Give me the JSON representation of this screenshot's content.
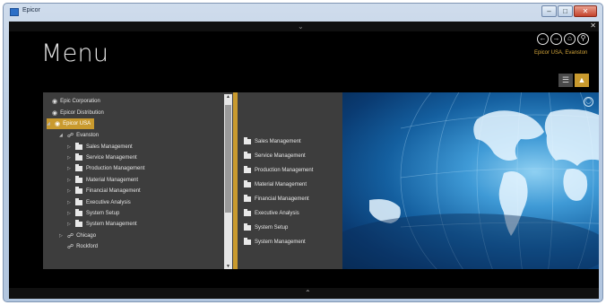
{
  "window": {
    "title": "Epicor"
  },
  "page": {
    "title": "Menu",
    "company_link": "Epicor USA, Evanston"
  },
  "toolbar": {
    "icons": [
      "back-icon",
      "forward-icon",
      "home-icon",
      "search-icon"
    ],
    "view_buttons": [
      "list-view-icon",
      "tile-view-icon"
    ]
  },
  "tree": [
    {
      "label": "Epic Corporation",
      "depth": 0,
      "icon": "company-icon"
    },
    {
      "label": "Epicor Distribution",
      "depth": 0,
      "icon": "company-icon"
    },
    {
      "label": "Epicor USA",
      "depth": 0,
      "icon": "company-icon",
      "selected": true,
      "expanded": true
    },
    {
      "label": "Evanston",
      "depth": 1,
      "icon": "site-icon",
      "expanded": true
    },
    {
      "label": "Sales Management",
      "depth": 2,
      "icon": "folder-icon"
    },
    {
      "label": "Service Management",
      "depth": 2,
      "icon": "folder-icon"
    },
    {
      "label": "Production Management",
      "depth": 2,
      "icon": "folder-icon"
    },
    {
      "label": "Material Management",
      "depth": 2,
      "icon": "folder-icon"
    },
    {
      "label": "Financial Management",
      "depth": 2,
      "icon": "folder-icon"
    },
    {
      "label": "Executive Analysis",
      "depth": 2,
      "icon": "folder-icon"
    },
    {
      "label": "System Setup",
      "depth": 2,
      "icon": "folder-icon"
    },
    {
      "label": "System Management",
      "depth": 2,
      "icon": "folder-icon"
    },
    {
      "label": "Chicago",
      "depth": 1,
      "icon": "site-icon"
    },
    {
      "label": "Rockford",
      "depth": 1,
      "icon": "site-icon"
    }
  ],
  "submenu": [
    "Sales Management",
    "Service Management",
    "Production Management",
    "Material Management",
    "Financial Management",
    "Executive Analysis",
    "System Setup",
    "System Management"
  ],
  "colors": {
    "accent": "#c99a2e",
    "panel": "#3d3d3d",
    "background": "#000000"
  }
}
